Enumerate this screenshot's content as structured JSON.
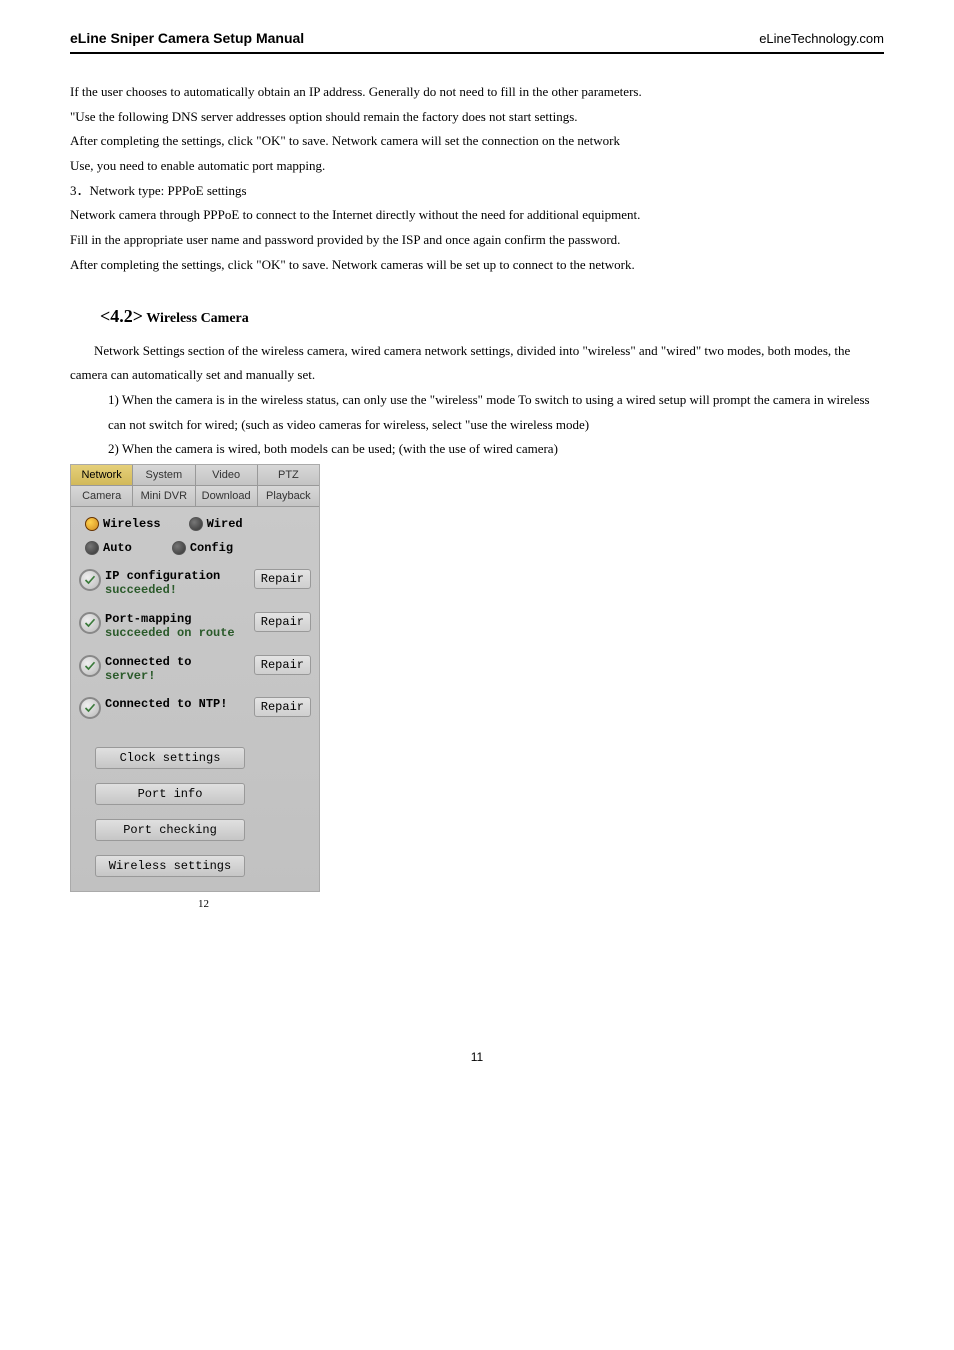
{
  "header": {
    "left": "eLine Sniper Camera Setup Manual",
    "right": "eLineTechnology.com"
  },
  "body": {
    "p1": "If the user chooses to automatically obtain an IP address. Generally do not need to fill in the other parameters.",
    "p2": "\"Use the following DNS server addresses option should remain the factory does not start settings.",
    "p3": "After completing the settings, click \"OK\" to save. Network camera will set the connection on the network",
    "p4": "Use, you need to enable automatic port mapping.",
    "p5": "3．Network type: PPPoE settings",
    "p6": "Network camera through PPPoE to connect to the Internet directly without the need for additional equipment.",
    "p7": "Fill in the appropriate user name and password provided by the ISP and once again confirm the password.",
    "p8": "After completing the settings, click \"OK\" to save. Network cameras will be set up to connect to the network."
  },
  "section": {
    "num": "<4.2>",
    "label": " Wireless Camera",
    "desc": "Network Settings section of the wireless camera, wired camera network settings, divided into \"wireless\" and \"wired\" two modes, both modes, the camera can automatically set and manually set.",
    "i1": "1) When the camera is in the wireless status, can only use the \"wireless\" mode To switch to using a wired setup will prompt the camera in wireless can not switch for wired; (such as video cameras for wireless, select \"use the wireless mode)",
    "i2": "2) When the camera is wired, both models can be used; (with the use of wired camera)"
  },
  "panel": {
    "tabs1": {
      "t0": "Network",
      "t1": "System",
      "t2": "Video",
      "t3": "PTZ"
    },
    "tabs2": {
      "t0": "Camera",
      "t1": "Mini DVR",
      "t2": "Download",
      "t3": "Playback"
    },
    "radios1": {
      "r0": "Wireless",
      "r1": "Wired"
    },
    "radios2": {
      "r0": "Auto",
      "r1": "Config"
    },
    "status": {
      "s0a": "IP configuration",
      "s0b": "succeeded!",
      "s1a": "Port-mapping",
      "s1b": "succeeded on route",
      "s2a": "Connected to",
      "s2b": "server!",
      "s3a": "Connected to NTP!"
    },
    "repair": "Repair",
    "buttons": {
      "b0": "Clock settings",
      "b1": "Port info",
      "b2": "Port checking",
      "b3": "Wireless settings"
    }
  },
  "pg_inner": "12",
  "pg_footer": "11"
}
